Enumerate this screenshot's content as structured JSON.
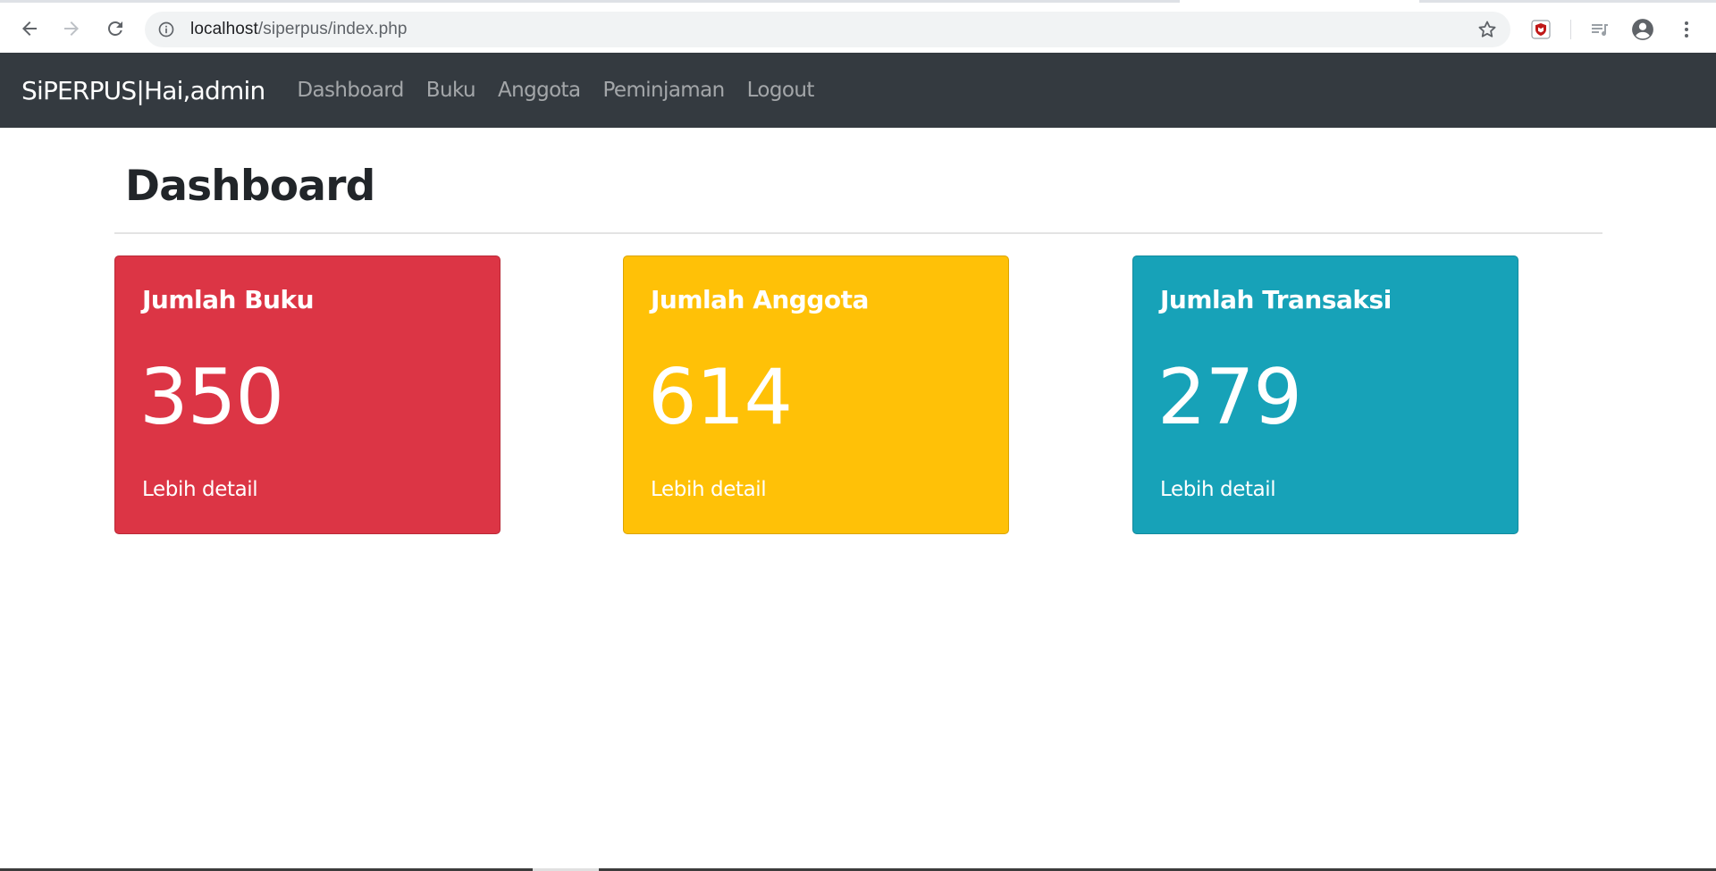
{
  "browser": {
    "url_host": "localhost",
    "url_path": "/siperpus/index.php",
    "icons": {
      "back": "arrow-left-icon",
      "forward": "arrow-right-icon",
      "reload": "reload-icon",
      "site_info": "info-circle-icon",
      "bookmark": "star-outline-icon",
      "extension": "mcafee-shield-icon",
      "media": "playlist-icon",
      "profile": "account-circle-icon",
      "menu": "kebab-menu-icon"
    }
  },
  "navbar": {
    "brand": "SiPERPUS|Hai,admin",
    "background": "#343a40",
    "links": [
      {
        "label": "Dashboard"
      },
      {
        "label": "Buku"
      },
      {
        "label": "Anggota"
      },
      {
        "label": "Peminjaman"
      },
      {
        "label": "Logout"
      }
    ]
  },
  "main": {
    "title": "Dashboard",
    "cards": [
      {
        "title": "Jumlah Buku",
        "value": "350",
        "link": "Lebih detail",
        "color": "#dc3545"
      },
      {
        "title": "Jumlah Anggota",
        "value": "614",
        "link": "Lebih detail",
        "color": "#ffc107"
      },
      {
        "title": "Jumlah Transaksi",
        "value": "279",
        "link": "Lebih detail",
        "color": "#17a2b8"
      }
    ]
  }
}
